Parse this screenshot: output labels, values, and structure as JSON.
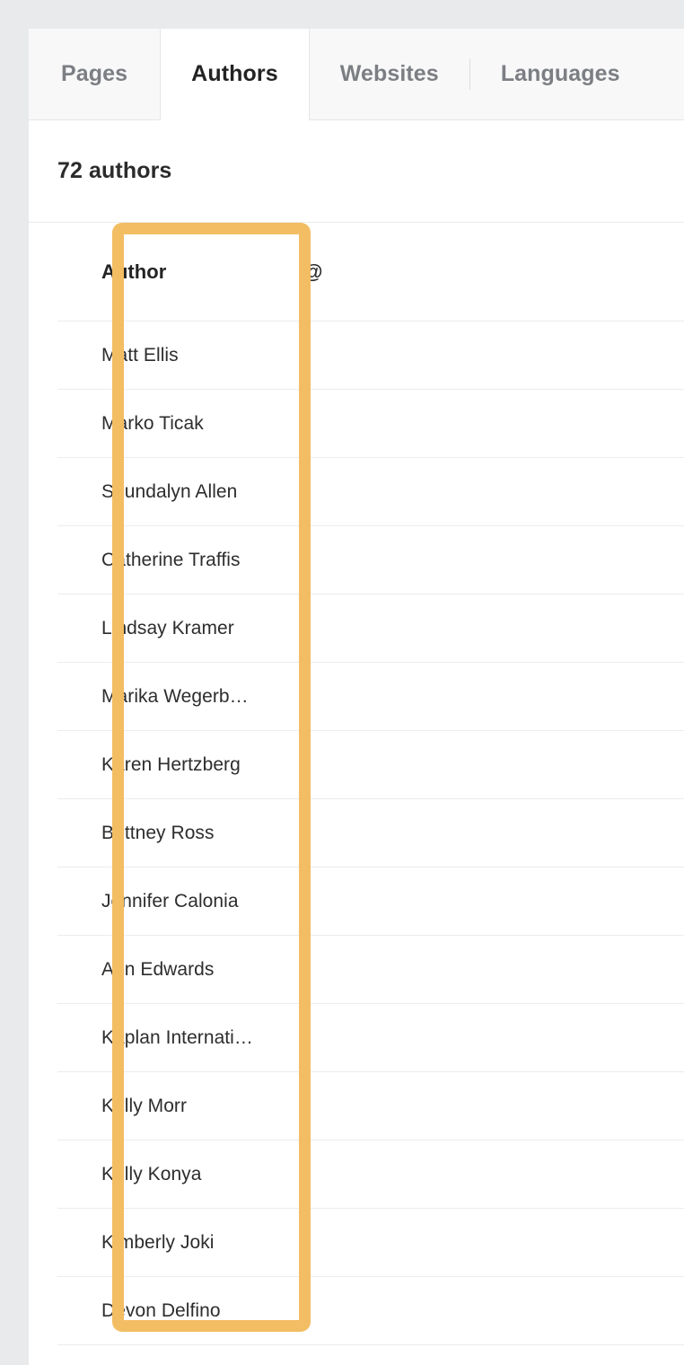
{
  "tabs": [
    {
      "label": "Pages",
      "active": false
    },
    {
      "label": "Authors",
      "active": true
    },
    {
      "label": "Websites",
      "active": false
    },
    {
      "label": "Languages",
      "active": false
    }
  ],
  "summary": {
    "count_label": "72 authors"
  },
  "table": {
    "columns": [
      {
        "key": "author",
        "label": "Author"
      },
      {
        "key": "at",
        "label": "@"
      }
    ],
    "rows": [
      {
        "author": "Matt Ellis",
        "at": ""
      },
      {
        "author": "Marko Ticak",
        "at": ""
      },
      {
        "author": "Shundalyn Allen",
        "at": ""
      },
      {
        "author": "Catherine Traffis",
        "at": ""
      },
      {
        "author": "Lindsay Kramer",
        "at": ""
      },
      {
        "author": "Marika Wegerb…",
        "at": ""
      },
      {
        "author": "Karen Hertzberg",
        "at": ""
      },
      {
        "author": "Brittney Ross",
        "at": ""
      },
      {
        "author": "Jennifer Calonia",
        "at": ""
      },
      {
        "author": "Ann Edwards",
        "at": ""
      },
      {
        "author": "Kaplan Internati…",
        "at": ""
      },
      {
        "author": "Kelly Morr",
        "at": ""
      },
      {
        "author": "Kelly Konya",
        "at": ""
      },
      {
        "author": "Kimberly Joki",
        "at": ""
      },
      {
        "author": "Devon Delfino",
        "at": ""
      }
    ]
  },
  "highlight": {
    "color": "#f3bd63",
    "target_column": "Author"
  },
  "colors": {
    "page_background": "#e9eaec",
    "panel_background": "#ffffff",
    "tabbar_background": "#f8f8f8",
    "tab_inactive_text": "#7b7e83",
    "tab_active_text": "#232323",
    "row_divider": "#ececec",
    "body_text": "#2d2d2d",
    "highlight_orange": "#f3bd63"
  }
}
